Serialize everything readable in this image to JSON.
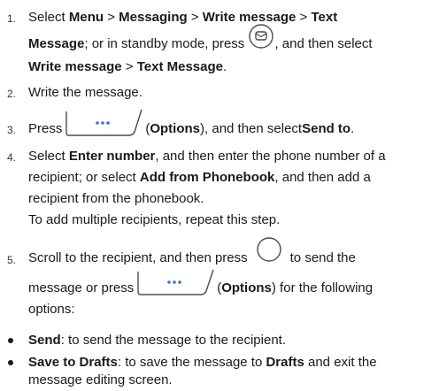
{
  "steps": [
    {
      "num": "1.",
      "part_a": "Select ",
      "menu": "Menu",
      "sep1": " > ",
      "messaging": "Messaging",
      "sep2": " > ",
      "write_message": "Write message",
      "sep3": " > ",
      "text": "Text",
      "message": "Message",
      "part_b": "; or in standby mode, press ",
      "part_c": ", and then select",
      "write_message2": "Write message",
      "sep4": " > ",
      "text_message": "Text Message",
      "period": "."
    },
    {
      "num": "2.",
      "text": "Write the message."
    },
    {
      "num": "3.",
      "press": "Press ",
      "options_open": " (",
      "options": "Options",
      "rest": "), and then select ",
      "send_to": "Send to",
      "period": "."
    },
    {
      "num": "4.",
      "select": "Select ",
      "enter_number": "Enter number",
      "rest1": ", and then enter the phone number of a",
      "rest2": "recipient; or select ",
      "add_from": "Add from Phonebook",
      "rest3": ", and then add a",
      "rest4": "recipient from the phonebook.",
      "rest5": "To add multiple recipients, repeat this step."
    },
    {
      "num": "5.",
      "line1a": "Scroll to the recipient, and then press ",
      "line1b": " to send the",
      "line2a": "message or press ",
      "options_open": " (",
      "options": "Options",
      "line2b": ") for the following",
      "line3": "options:"
    }
  ],
  "bullets": [
    {
      "term": "Send",
      "desc": ": to send the message to the recipient."
    },
    {
      "term": "Save to Drafts",
      "desc1": ": to save the message to ",
      "drafts": "Drafts",
      "desc2": " and exit the",
      "desc3": "message editing screen."
    }
  ],
  "icons": {
    "message_key": "message-key-icon",
    "options_key": "options-softkey-icon",
    "center_key": "center-key-icon"
  },
  "colors": {
    "icon_stroke": "#4a4a4a",
    "icon_dots": "#3a6fd8",
    "text": "#1a1a1a"
  }
}
